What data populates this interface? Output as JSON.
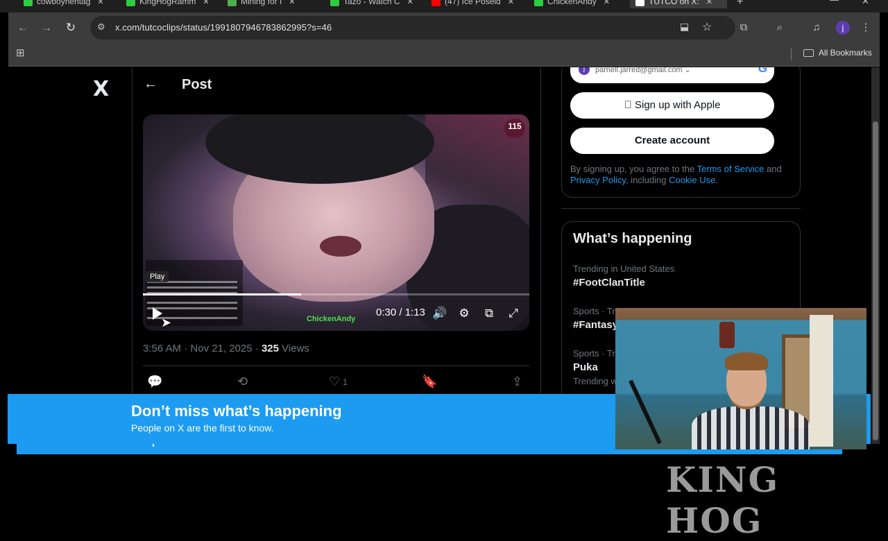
{
  "tabs": [
    {
      "title": "cowboyhentag",
      "favicon_color": "#2ecc40"
    },
    {
      "title": "KingHogRamm",
      "favicon_color": "#2ecc40"
    },
    {
      "title": "Mining for I",
      "favicon_color": "#4caf50"
    },
    {
      "title": "Tazo - Watch C",
      "favicon_color": "#2ecc40"
    },
    {
      "title": "(47) Ice Poseid",
      "favicon_color": "#ff0000"
    },
    {
      "title": "ChickenAndy",
      "favicon_color": "#2ecc40"
    },
    {
      "title": "TUTCO on X:",
      "favicon_color": "#ffffff",
      "active": true
    }
  ],
  "toolbar": {
    "url": "x.com/tutcoclips/status/1991807946783862995?s=46",
    "profile_initial": "j"
  },
  "bookmarks": {
    "all_label": "All Bookmarks"
  },
  "x_logo": "X",
  "post": {
    "header": "Post",
    "video": {
      "badge": "115",
      "play_tooltip": "Play",
      "time": "0:30 / 1:13",
      "progress": 0.41,
      "watermark": "ChickenAndy"
    },
    "time": "3:56 AM",
    "date": "Nov 21, 2025",
    "views_count": "325",
    "views_label": "Views",
    "likes": "1"
  },
  "signup": {
    "google_avatar": "j",
    "google_email": "parnell.jarred@gmail.com",
    "apple_label": "Sign up with Apple",
    "create_label": "Create account",
    "terms_prefix": "By signing up, you agree to the ",
    "terms_link": "Terms of Service",
    "terms_and": " and",
    "privacy_link": "Privacy Policy",
    "terms_including": ", including ",
    "cookie_link": "Cookie Use",
    "terms_end": "."
  },
  "happening": {
    "title": "What’s happening",
    "trends": [
      {
        "context": "Trending in United States",
        "name": "#FootClanTitle"
      },
      {
        "context": "Sports · Tre",
        "name": "#Fantasy"
      },
      {
        "context": "Sports · Tr",
        "name": "Puka"
      },
      {
        "context": "Trending w",
        "name": ""
      }
    ]
  },
  "banner": {
    "title": "Don’t miss what’s happening",
    "subtitle": "People on X are the first to know."
  },
  "logo_text": "KING HOG",
  "colors": {
    "accent": "#1d9bf0",
    "background": "#000000",
    "chrome": "#3c3c3c"
  }
}
